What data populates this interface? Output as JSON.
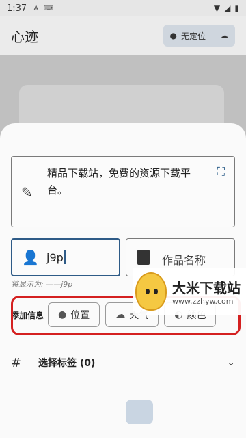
{
  "status": {
    "time": "1:37",
    "notif_icon": "A",
    "keyboard_icon": "keyboard-icon"
  },
  "app": {
    "title": "心迹",
    "location_chip": "无定位"
  },
  "sheet": {
    "content_text": "精品下载站，免费的资源下载平台。",
    "author_value": "j9p",
    "work_placeholder": "作品名称",
    "display_hint": "将显示为: ——j9p",
    "info_label": "添加信息",
    "chips": [
      "位置",
      "天气",
      "颜色"
    ],
    "tags_label": "选择标签 (0)"
  },
  "watermark": {
    "title": "大米下载站",
    "url": "www.zzhyw.com"
  },
  "colors": {
    "accent": "#2e5b87",
    "highlight": "#d42020"
  }
}
